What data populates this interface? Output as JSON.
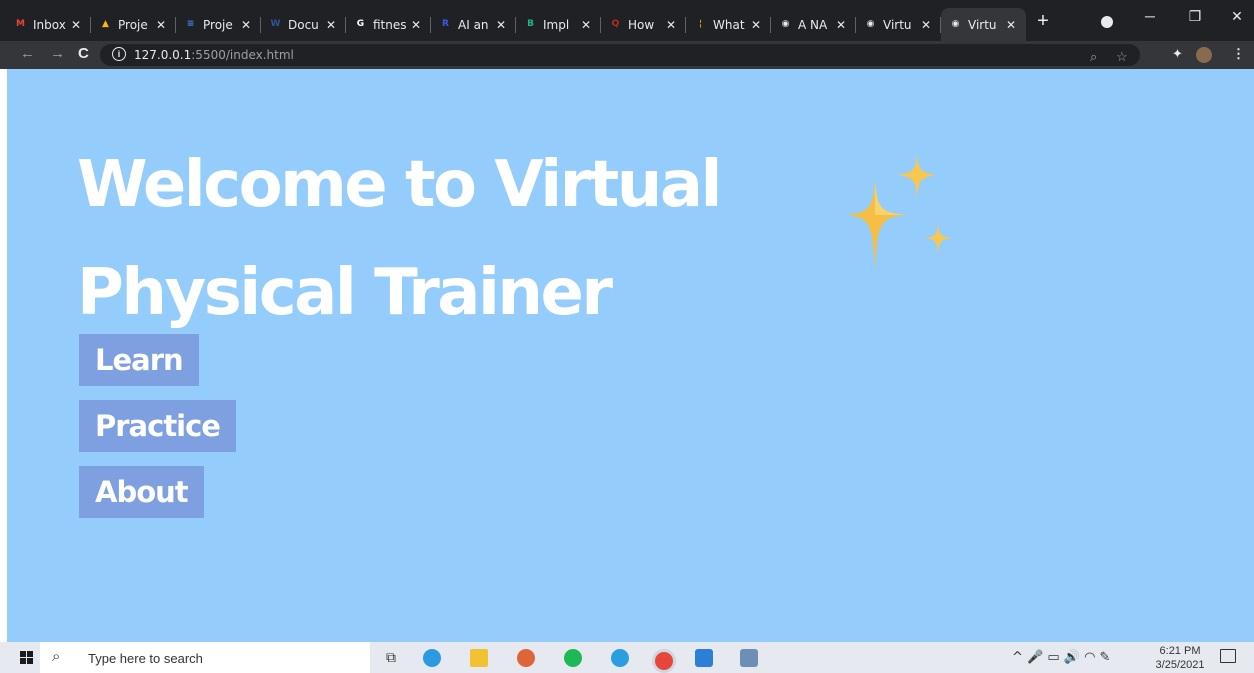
{
  "browser": {
    "tabs": [
      {
        "label": "Inbox",
        "icon": "gmail-icon",
        "color": "#ea4335",
        "glyph": "M"
      },
      {
        "label": "Proje",
        "icon": "google-drive-icon",
        "color": "#fbbc04",
        "glyph": "▲"
      },
      {
        "label": "Proje",
        "icon": "google-docs-icon",
        "color": "#4285f4",
        "glyph": "≡"
      },
      {
        "label": "Docu",
        "icon": "word-icon",
        "color": "#2b579a",
        "glyph": "W"
      },
      {
        "label": "fitnes",
        "icon": "google-icon",
        "color": "#ffffff",
        "glyph": "G"
      },
      {
        "label": "AI an",
        "icon": "app-icon",
        "color": "#3b5bdb",
        "glyph": "R"
      },
      {
        "label": "Impl",
        "icon": "app-icon",
        "color": "#1fb589",
        "glyph": "B"
      },
      {
        "label": "How",
        "icon": "quora-icon",
        "color": "#b92b27",
        "glyph": "Q"
      },
      {
        "label": "What",
        "icon": "app-icon",
        "color": "#d4a017",
        "glyph": "¦"
      },
      {
        "label": "A NA",
        "icon": "globe-icon",
        "color": "#e8eaed",
        "glyph": "◉"
      },
      {
        "label": "Virtu",
        "icon": "globe-icon",
        "color": "#e8eaed",
        "glyph": "◉"
      },
      {
        "label": "Virtu",
        "icon": "globe-icon",
        "color": "#e8eaed",
        "glyph": "◉",
        "active": true
      }
    ],
    "new_tab": "+",
    "url_host": "127.0.0.1",
    "url_rest": ":5500/index.html"
  },
  "page": {
    "title": "Welcome to Virtual Physical Trainer",
    "menu": [
      "Learn",
      "Practice",
      "About"
    ],
    "background": "#94ccfb",
    "button_color": "#7e9fe0",
    "sparkle_color": "#f7c24a"
  },
  "taskbar": {
    "search_placeholder": "Type here to search",
    "time": "6:21 PM",
    "date": "3/25/2021"
  }
}
